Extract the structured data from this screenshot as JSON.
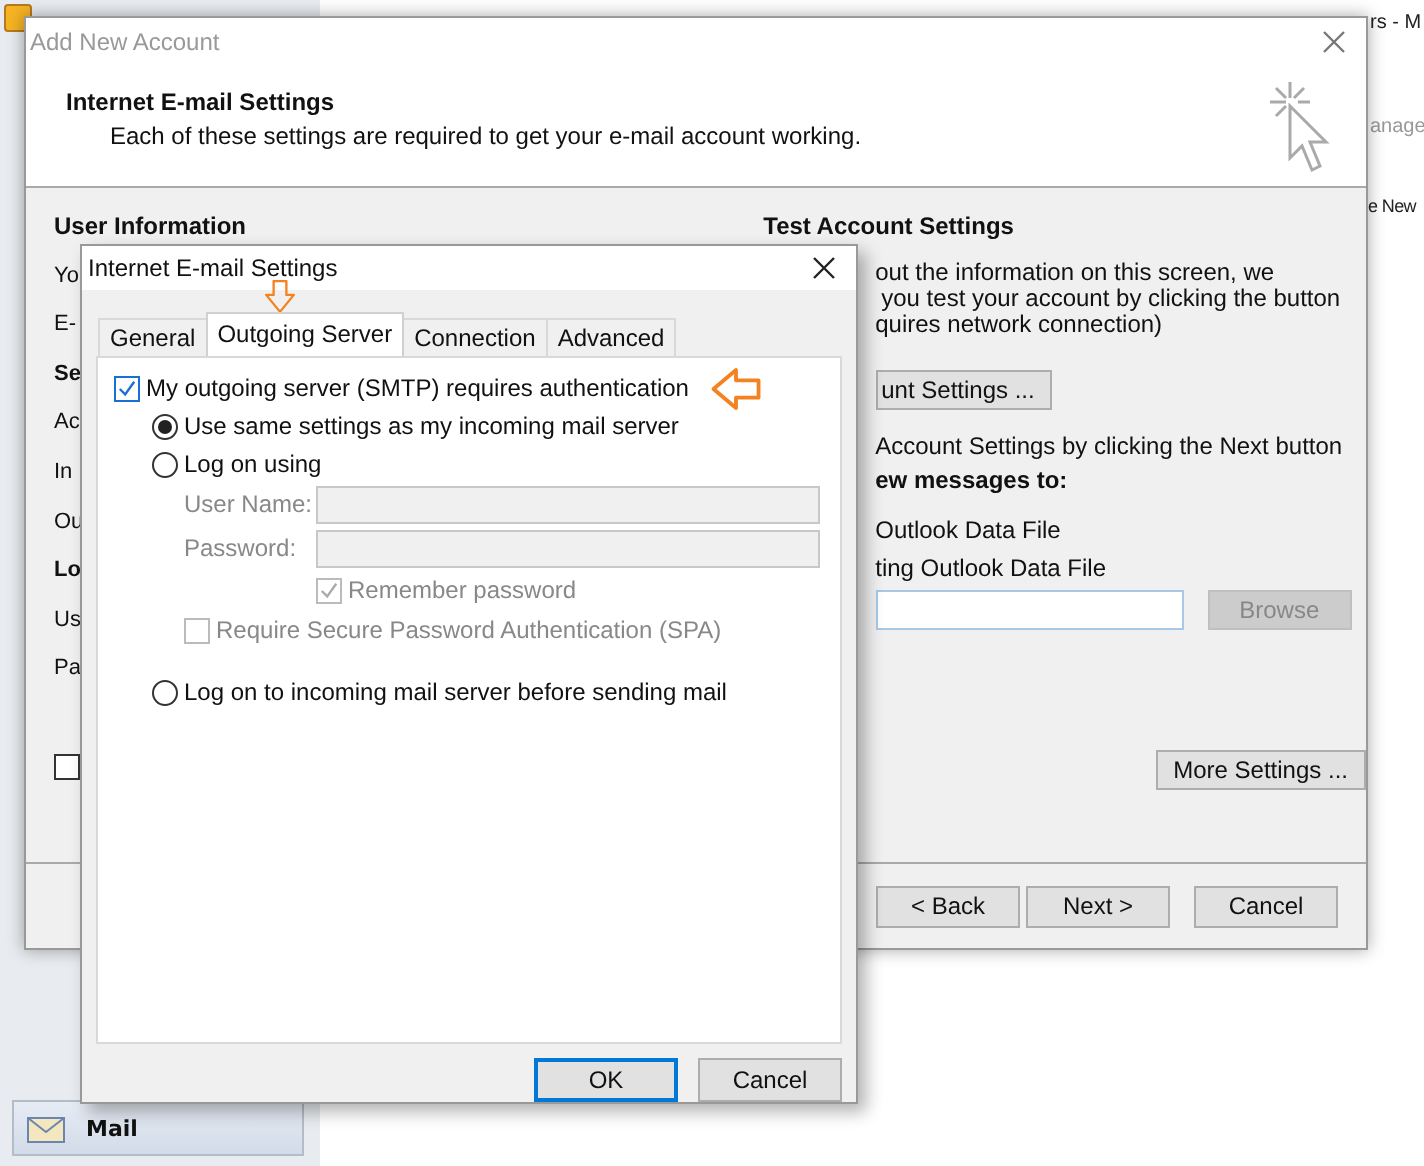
{
  "app": {
    "title_fragment": "rs - M",
    "ribbon_fragment": "anage",
    "toolbar_fragment": "e New",
    "nav_button": "Mail"
  },
  "account_dialog": {
    "title": "Add New Account",
    "heading": "Internet E-mail Settings",
    "subheading": "Each of these settings are required to get your e-mail account working.",
    "left_items": [
      {
        "kind": "heading",
        "text": "User Information"
      },
      {
        "kind": "label",
        "text": "Yo"
      },
      {
        "kind": "label",
        "text": "E-"
      },
      {
        "kind": "heading",
        "text": "Se"
      },
      {
        "kind": "label",
        "text": "Ac"
      },
      {
        "kind": "label",
        "text": "In"
      },
      {
        "kind": "label",
        "text": "Ou"
      },
      {
        "kind": "heading",
        "text": "Lo"
      },
      {
        "kind": "label",
        "text": "Us"
      },
      {
        "kind": "label",
        "text": "Pa"
      }
    ],
    "left_checkbox": {
      "checked": false
    },
    "right_heading": "Test Account Settings",
    "right_lines": [
      "out the information on this screen, we",
      "you test your account by clicking the button",
      "quires network connection)"
    ],
    "test_button": "unt Settings ...",
    "next_note": "Account Settings by clicking the Next button",
    "deliver_heading": "ew messages to:",
    "deliver_options": [
      "Outlook Data File",
      "ting Outlook Data File"
    ],
    "browse_button": {
      "label": "Browse",
      "disabled": true
    },
    "more_settings_button": "More Settings ...",
    "buttons": [
      "< Back",
      "Next >",
      "Cancel"
    ]
  },
  "settings_dialog": {
    "title": "Internet E-mail Settings",
    "tabs": [
      {
        "label": "General",
        "selected": false
      },
      {
        "label": "Outgoing Server",
        "selected": true
      },
      {
        "label": "Connection",
        "selected": false
      },
      {
        "label": "Advanced",
        "selected": false
      }
    ],
    "auth": {
      "label": "My outgoing server (SMTP) requires authentication",
      "checked": true,
      "children": [
        {
          "kind": "radio",
          "label": "Use same settings as my incoming mail server",
          "selected": true
        },
        {
          "kind": "radio",
          "label": "Log on using",
          "selected": false,
          "children": [
            {
              "kind": "field",
              "label": "User Name:",
              "disabled": true
            },
            {
              "kind": "field",
              "label": "Password:",
              "disabled": true
            },
            {
              "kind": "field_checkbox",
              "label": "Remember password",
              "checked": true,
              "disabled": true
            },
            {
              "kind": "checkbox",
              "label": "Require Secure Password Authentication (SPA)",
              "checked": false,
              "disabled": true
            }
          ]
        },
        {
          "kind": "radio",
          "label": "Log on to incoming mail server before sending mail",
          "selected": false
        }
      ]
    },
    "buttons": [
      {
        "label": "OK",
        "default": true
      },
      {
        "label": "Cancel",
        "default": false
      }
    ]
  }
}
